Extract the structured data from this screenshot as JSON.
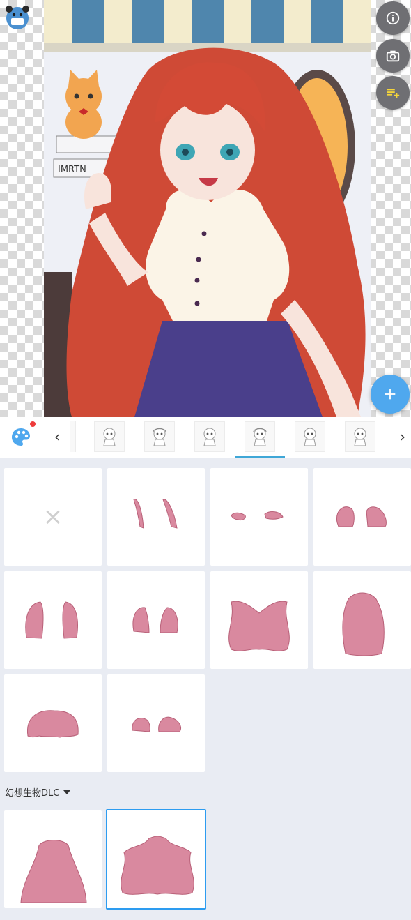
{
  "app": {
    "logo_icon": "panda-bear-logo-icon",
    "info_icon": "info-icon",
    "camera_icon": "camera-icon",
    "playlist_icon": "playlist-add-icon",
    "add_icon": "plus-icon"
  },
  "colors": {
    "fab": "#4fa8ee",
    "round_button": "#6f6f73",
    "hair": "#d9899f",
    "selection": "#2d9cf0",
    "tab_indicator": "#3fa7d7"
  },
  "category_strip": {
    "palette_icon": "palette-icon",
    "prev_label": "‹",
    "next_label": "›",
    "selected_tab": 3,
    "tabs": [
      "hair-category-1",
      "hair-category-2",
      "hair-category-3",
      "hair-category-4",
      "hair-category-5",
      "hair-category-6"
    ]
  },
  "grid": {
    "none_label": "×",
    "items": [
      "none",
      "side-locks",
      "short-bangs",
      "bob-sides",
      "long-sides",
      "short-locks",
      "wavy-long-back",
      "long-straight-back",
      "short-back",
      "small-buns"
    ]
  },
  "dlc_section": {
    "label": "幻想生物DLC",
    "items": [
      "straight-back-hair",
      "curly-back-hair"
    ],
    "selected_index": 1
  }
}
